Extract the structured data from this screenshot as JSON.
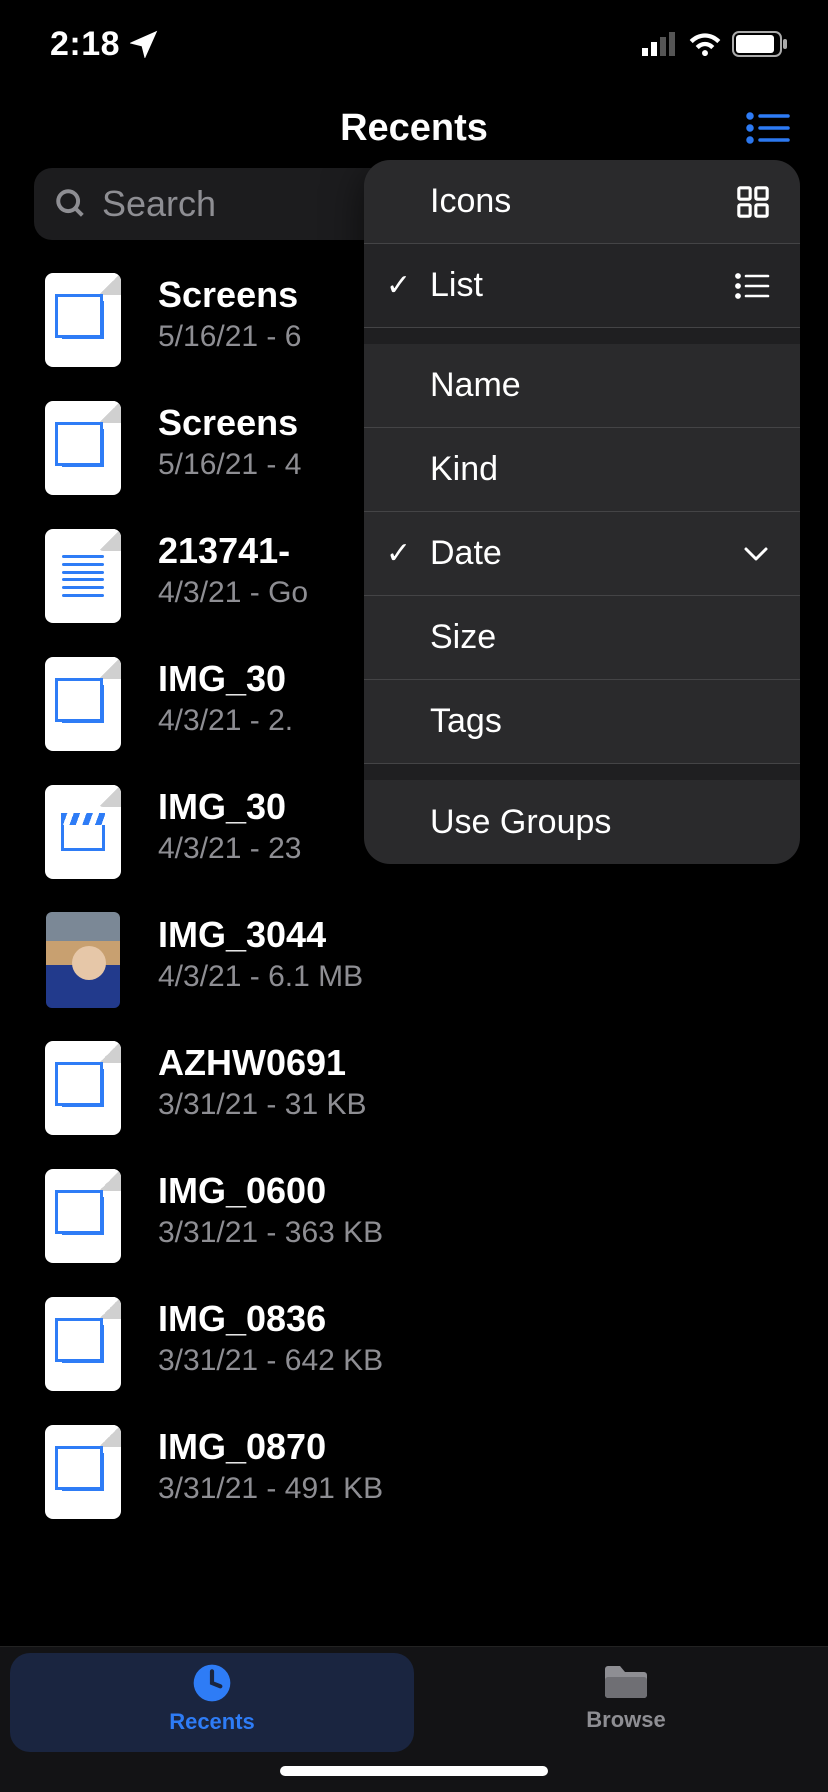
{
  "status": {
    "time": "2:18"
  },
  "header": {
    "title": "Recents"
  },
  "search": {
    "placeholder": "Search"
  },
  "files": [
    {
      "name": "Screens",
      "meta": "5/16/21 - 6",
      "icon": "stack"
    },
    {
      "name": "Screens",
      "meta": "5/16/21 - 4",
      "icon": "stack"
    },
    {
      "name": "213741-",
      "meta": "4/3/21 - Go",
      "icon": "lines"
    },
    {
      "name": "IMG_30",
      "meta": "4/3/21 - 2.",
      "icon": "stack"
    },
    {
      "name": "IMG_30",
      "meta": "4/3/21 - 23",
      "icon": "clapper"
    },
    {
      "name": "IMG_3044",
      "meta": "4/3/21 - 6.1 MB",
      "icon": "photo"
    },
    {
      "name": "AZHW0691",
      "meta": "3/31/21 - 31 KB",
      "icon": "stack"
    },
    {
      "name": "IMG_0600",
      "meta": "3/31/21 - 363 KB",
      "icon": "stack"
    },
    {
      "name": "IMG_0836",
      "meta": "3/31/21 - 642 KB",
      "icon": "stack"
    },
    {
      "name": "IMG_0870",
      "meta": "3/31/21 - 491 KB",
      "icon": "stack"
    }
  ],
  "popover": {
    "icons": "Icons",
    "list": "List",
    "name": "Name",
    "kind": "Kind",
    "date": "Date",
    "size": "Size",
    "tags": "Tags",
    "use_groups": "Use Groups",
    "view_selected": "list",
    "sort_selected": "date"
  },
  "tabs": {
    "recents": "Recents",
    "browse": "Browse"
  }
}
